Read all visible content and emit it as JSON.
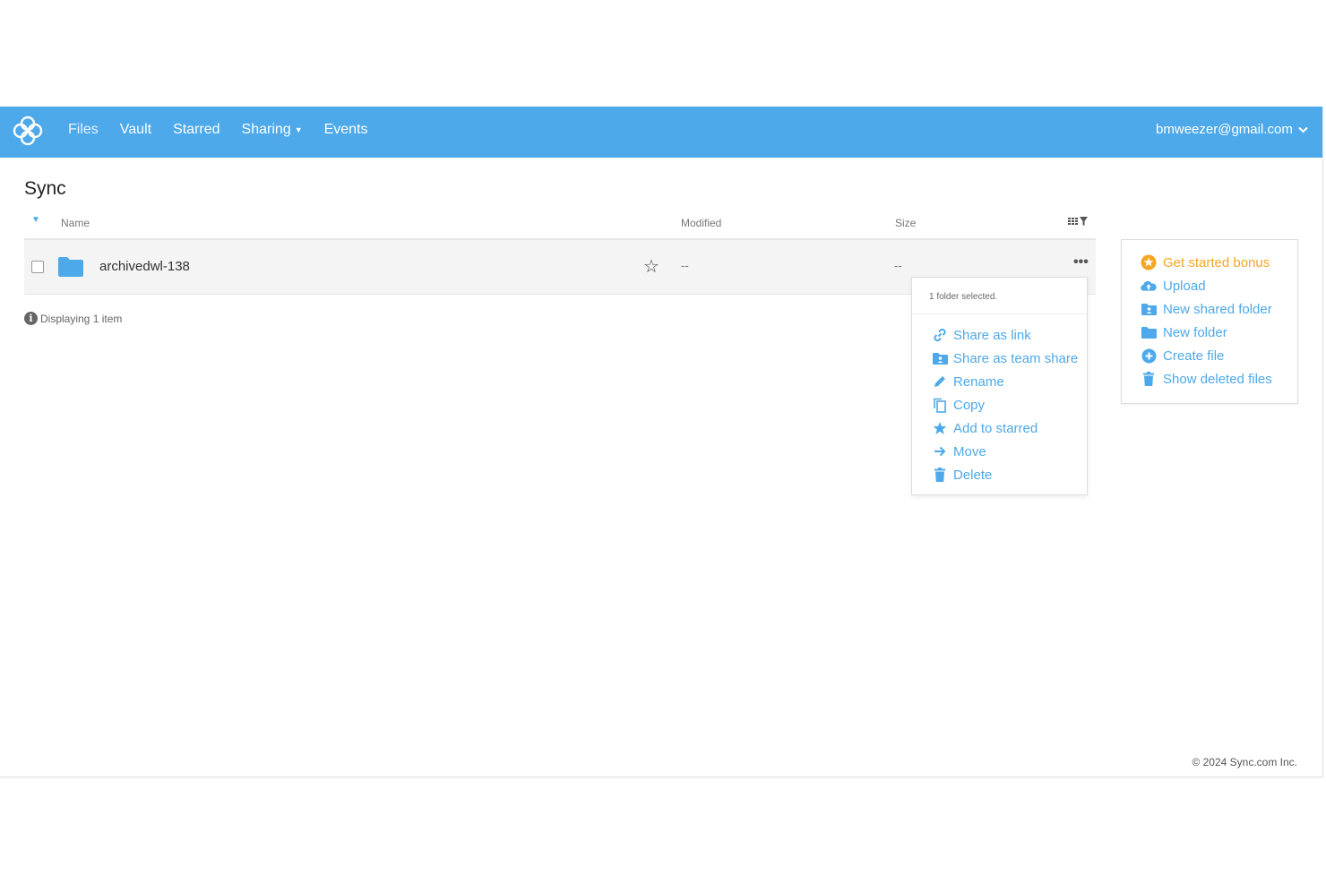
{
  "nav": {
    "items": [
      {
        "label": "Files"
      },
      {
        "label": "Vault"
      },
      {
        "label": "Starred"
      },
      {
        "label": "Sharing",
        "has_caret": true
      },
      {
        "label": "Events"
      }
    ],
    "user_email": "bmweezer@gmail.com"
  },
  "page": {
    "title": "Sync"
  },
  "table": {
    "columns": {
      "name": "Name",
      "modified": "Modified",
      "size": "Size"
    },
    "rows": [
      {
        "name": "archivedwl-138",
        "modified": "--",
        "size": "--",
        "more": "•••"
      }
    ],
    "display_count": "Displaying 1 item"
  },
  "context_menu": {
    "header": "1 folder selected.",
    "items": [
      {
        "label": "Share as link",
        "icon": "link-icon"
      },
      {
        "label": "Share as team share",
        "icon": "team-share-icon"
      },
      {
        "label": "Rename",
        "icon": "pencil-icon"
      },
      {
        "label": "Copy",
        "icon": "copy-icon"
      },
      {
        "label": "Add to starred",
        "icon": "star-icon"
      },
      {
        "label": "Move",
        "icon": "arrow-right-icon"
      },
      {
        "label": "Delete",
        "icon": "trash-icon"
      }
    ]
  },
  "sidebar": {
    "items": [
      {
        "label": "Get started bonus",
        "icon": "bonus-icon"
      },
      {
        "label": "Upload",
        "icon": "cloud-upload-icon"
      },
      {
        "label": "New shared folder",
        "icon": "shared-folder-icon"
      },
      {
        "label": "New folder",
        "icon": "folder-icon"
      },
      {
        "label": "Create file",
        "icon": "plus-circle-icon"
      },
      {
        "label": "Show deleted files",
        "icon": "trash-icon"
      }
    ]
  },
  "footer": {
    "copyright": "© 2024 Sync.com Inc."
  },
  "colors": {
    "brand": "#4da9e9",
    "accent_orange": "#f5a623",
    "row_bg": "#f4f4f4"
  }
}
